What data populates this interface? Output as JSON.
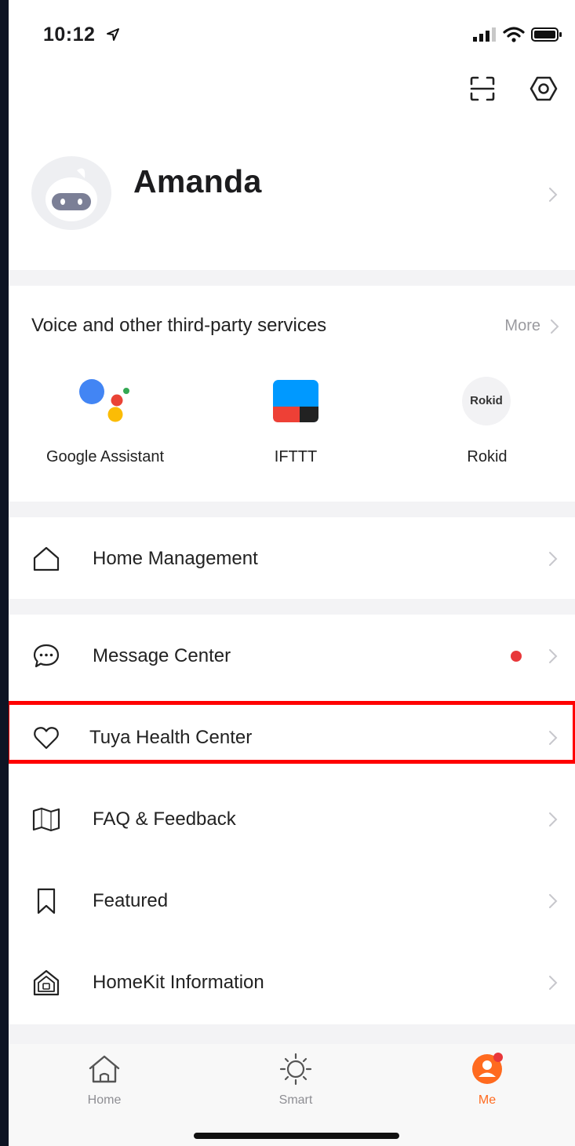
{
  "status_bar": {
    "time": "10:12"
  },
  "profile": {
    "name": "Amanda"
  },
  "services": {
    "title": "Voice and other third-party services",
    "more_label": "More",
    "items": [
      {
        "label": "Google Assistant",
        "icon": "google-assistant-icon"
      },
      {
        "label": "IFTTT",
        "icon": "ifttt-icon"
      },
      {
        "label": "Rokid",
        "icon": "rokid-icon",
        "logo_text": "Rokid"
      }
    ]
  },
  "menu": [
    {
      "label": "Home Management",
      "icon": "home-outline-icon"
    },
    {
      "label": "Message Center",
      "icon": "chat-bubble-icon",
      "has_dot": true
    },
    {
      "label": "Tuya Health Center",
      "icon": "heart-icon"
    },
    {
      "label": "FAQ & Feedback",
      "icon": "book-icon"
    },
    {
      "label": "Featured",
      "icon": "bookmark-icon"
    },
    {
      "label": "HomeKit Information",
      "icon": "homekit-icon"
    }
  ],
  "tabbar": {
    "tabs": [
      {
        "label": "Home",
        "icon": "home-icon"
      },
      {
        "label": "Smart",
        "icon": "sun-icon"
      },
      {
        "label": "Me",
        "icon": "user-icon",
        "active": true
      }
    ]
  },
  "colors": {
    "accent": "#ff6a1f",
    "highlight": "#ff0000",
    "dot": "#e8373a"
  }
}
